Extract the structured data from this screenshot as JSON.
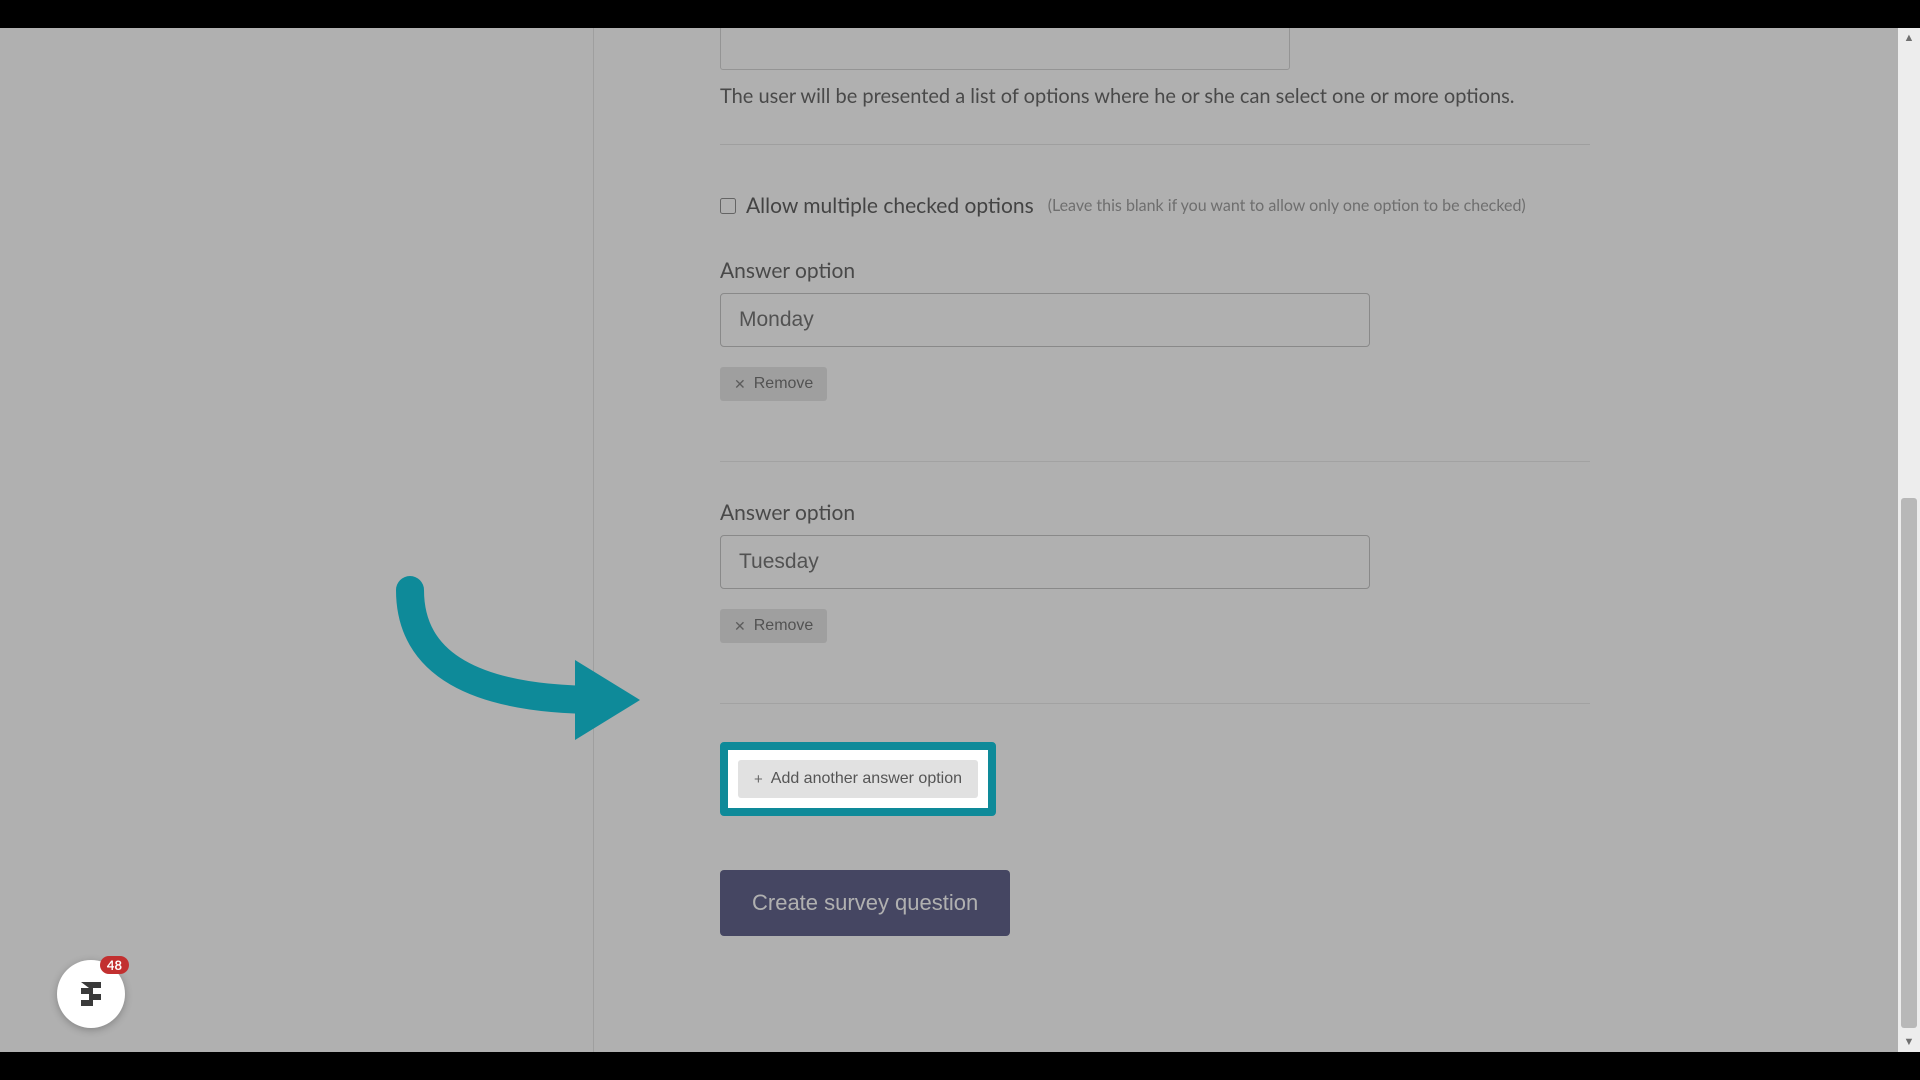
{
  "form": {
    "option_type_hint": "The user will be presented a list of options where he or she can select one or more options.",
    "allow_multiple_label": "Allow multiple checked options",
    "allow_multiple_hint": "(Leave this blank if you want to allow only one option to be checked)",
    "answer_option_label": "Answer option",
    "options": [
      {
        "value": "Monday"
      },
      {
        "value": "Tuesday"
      }
    ],
    "remove_label": "Remove",
    "add_option_label": "Add another answer option",
    "submit_label": "Create survey question"
  },
  "widget": {
    "count": "48"
  }
}
